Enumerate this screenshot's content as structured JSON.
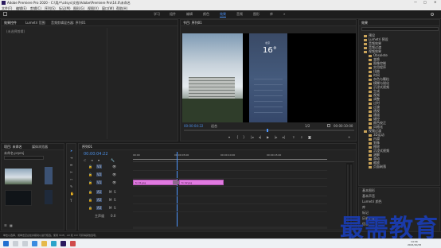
{
  "window": {
    "title": "Adobe Premiere Pro 2020 - C:\\用户\\cdsys\\文档\\Adobe\\Premiere Pro\\14.0\\未命名"
  },
  "menubar": {
    "items": [
      "文件(F)",
      "编辑(E)",
      "剪辑(C)",
      "序列(S)",
      "标记(M)",
      "图形(G)",
      "视图(V)",
      "窗口(W)",
      "帮助(H)"
    ]
  },
  "workspaces": {
    "items": [
      "学习",
      "组件",
      "编辑",
      "颜色",
      "效果",
      "音频",
      "图形",
      "库"
    ],
    "active": "效果"
  },
  "source_panel": {
    "tabs": [
      "效果控件",
      "Lumetri 范围",
      "音频剪辑混合器: 序列01"
    ],
    "empty_text": "(未选择剪辑)"
  },
  "program_monitor": {
    "title": "节目: 序列01",
    "timecode": "00:00:04:22",
    "fit": "适合",
    "quality": "1/2",
    "duration": "00:00:10:00",
    "phone": {
      "temp": "16°",
      "city": "北京"
    }
  },
  "project_panel": {
    "tabs": [
      "项目: 未命名",
      "媒体浏览器"
    ],
    "file": "未命名.prproj",
    "count": "1 项已选择，共 3 项"
  },
  "timeline": {
    "tab": "序列01",
    "timecode": "00:00:04:22",
    "ruler": [
      "00:00",
      "00:00:05:00",
      "00:00:10:00",
      "00:00:15:00"
    ],
    "video_tracks": [
      "V3",
      "V2",
      "V1"
    ],
    "audio_tracks": [
      "A1",
      "A2",
      "A3"
    ],
    "master": "主声道",
    "master_value": "0.0",
    "clips": [
      {
        "label": "fx 01.jpg"
      },
      {
        "label": "fx 02.jpg"
      }
    ],
    "clip_color": "#e07ae0"
  },
  "effects_panel": {
    "title": "效果",
    "items": [
      "预设",
      "Lumetri 预设",
      "音频效果",
      "音频过渡",
      "视频效果",
      "Obsolete",
      "变换",
      "图像控制",
      "实用程序",
      "扭曲",
      "时间",
      "杂色与颗粒",
      "模糊与锐化",
      "沉浸式视频",
      "生成",
      "视频",
      "调整",
      "过时",
      "过渡",
      "透视",
      "通道",
      "键控",
      "颜色校正",
      "风格化",
      "视频过渡",
      "3D运动",
      "内滑",
      "划像",
      "擦除",
      "沉浸式视频",
      "溶解",
      "滑动",
      "缩放",
      "页面剥落"
    ],
    "bottom_tabs": [
      "基本图形",
      "基本声音",
      "Lumetri 颜色",
      "库",
      "标记",
      "历史记录",
      "信息"
    ]
  },
  "status_bar": {
    "text": "单击以选择，或单击空白处并拖动以进行框选。使用 Shift、Alt 和 Ctrl 可获得其他选项。"
  },
  "taskbar": {
    "time": "14:34",
    "date": "2021/10/15"
  },
  "watermark": {
    "text": "最需教育"
  },
  "colors": {
    "accent": "#4d96ff",
    "clip": "#e07ae0",
    "watermark": "#1a3aa8"
  }
}
